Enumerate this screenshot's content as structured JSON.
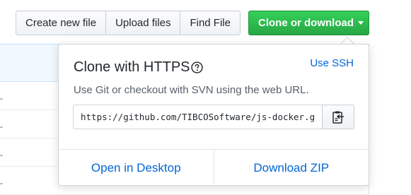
{
  "toolbar": {
    "create_label": "Create new file",
    "upload_label": "Upload files",
    "find_label": "Find File",
    "clone_label": "Clone or download"
  },
  "clone_panel": {
    "title": "Clone with HTTPS",
    "use_ssh": "Use SSH",
    "description": "Use Git or checkout with SVN using the web URL.",
    "url": "https://github.com/TIBCOSoftware/js-docker.git",
    "open_desktop": "Open in Desktop",
    "download_zip": "Download ZIP"
  },
  "colors": {
    "accent": "#0366d6",
    "clone_green": "#28a745"
  }
}
